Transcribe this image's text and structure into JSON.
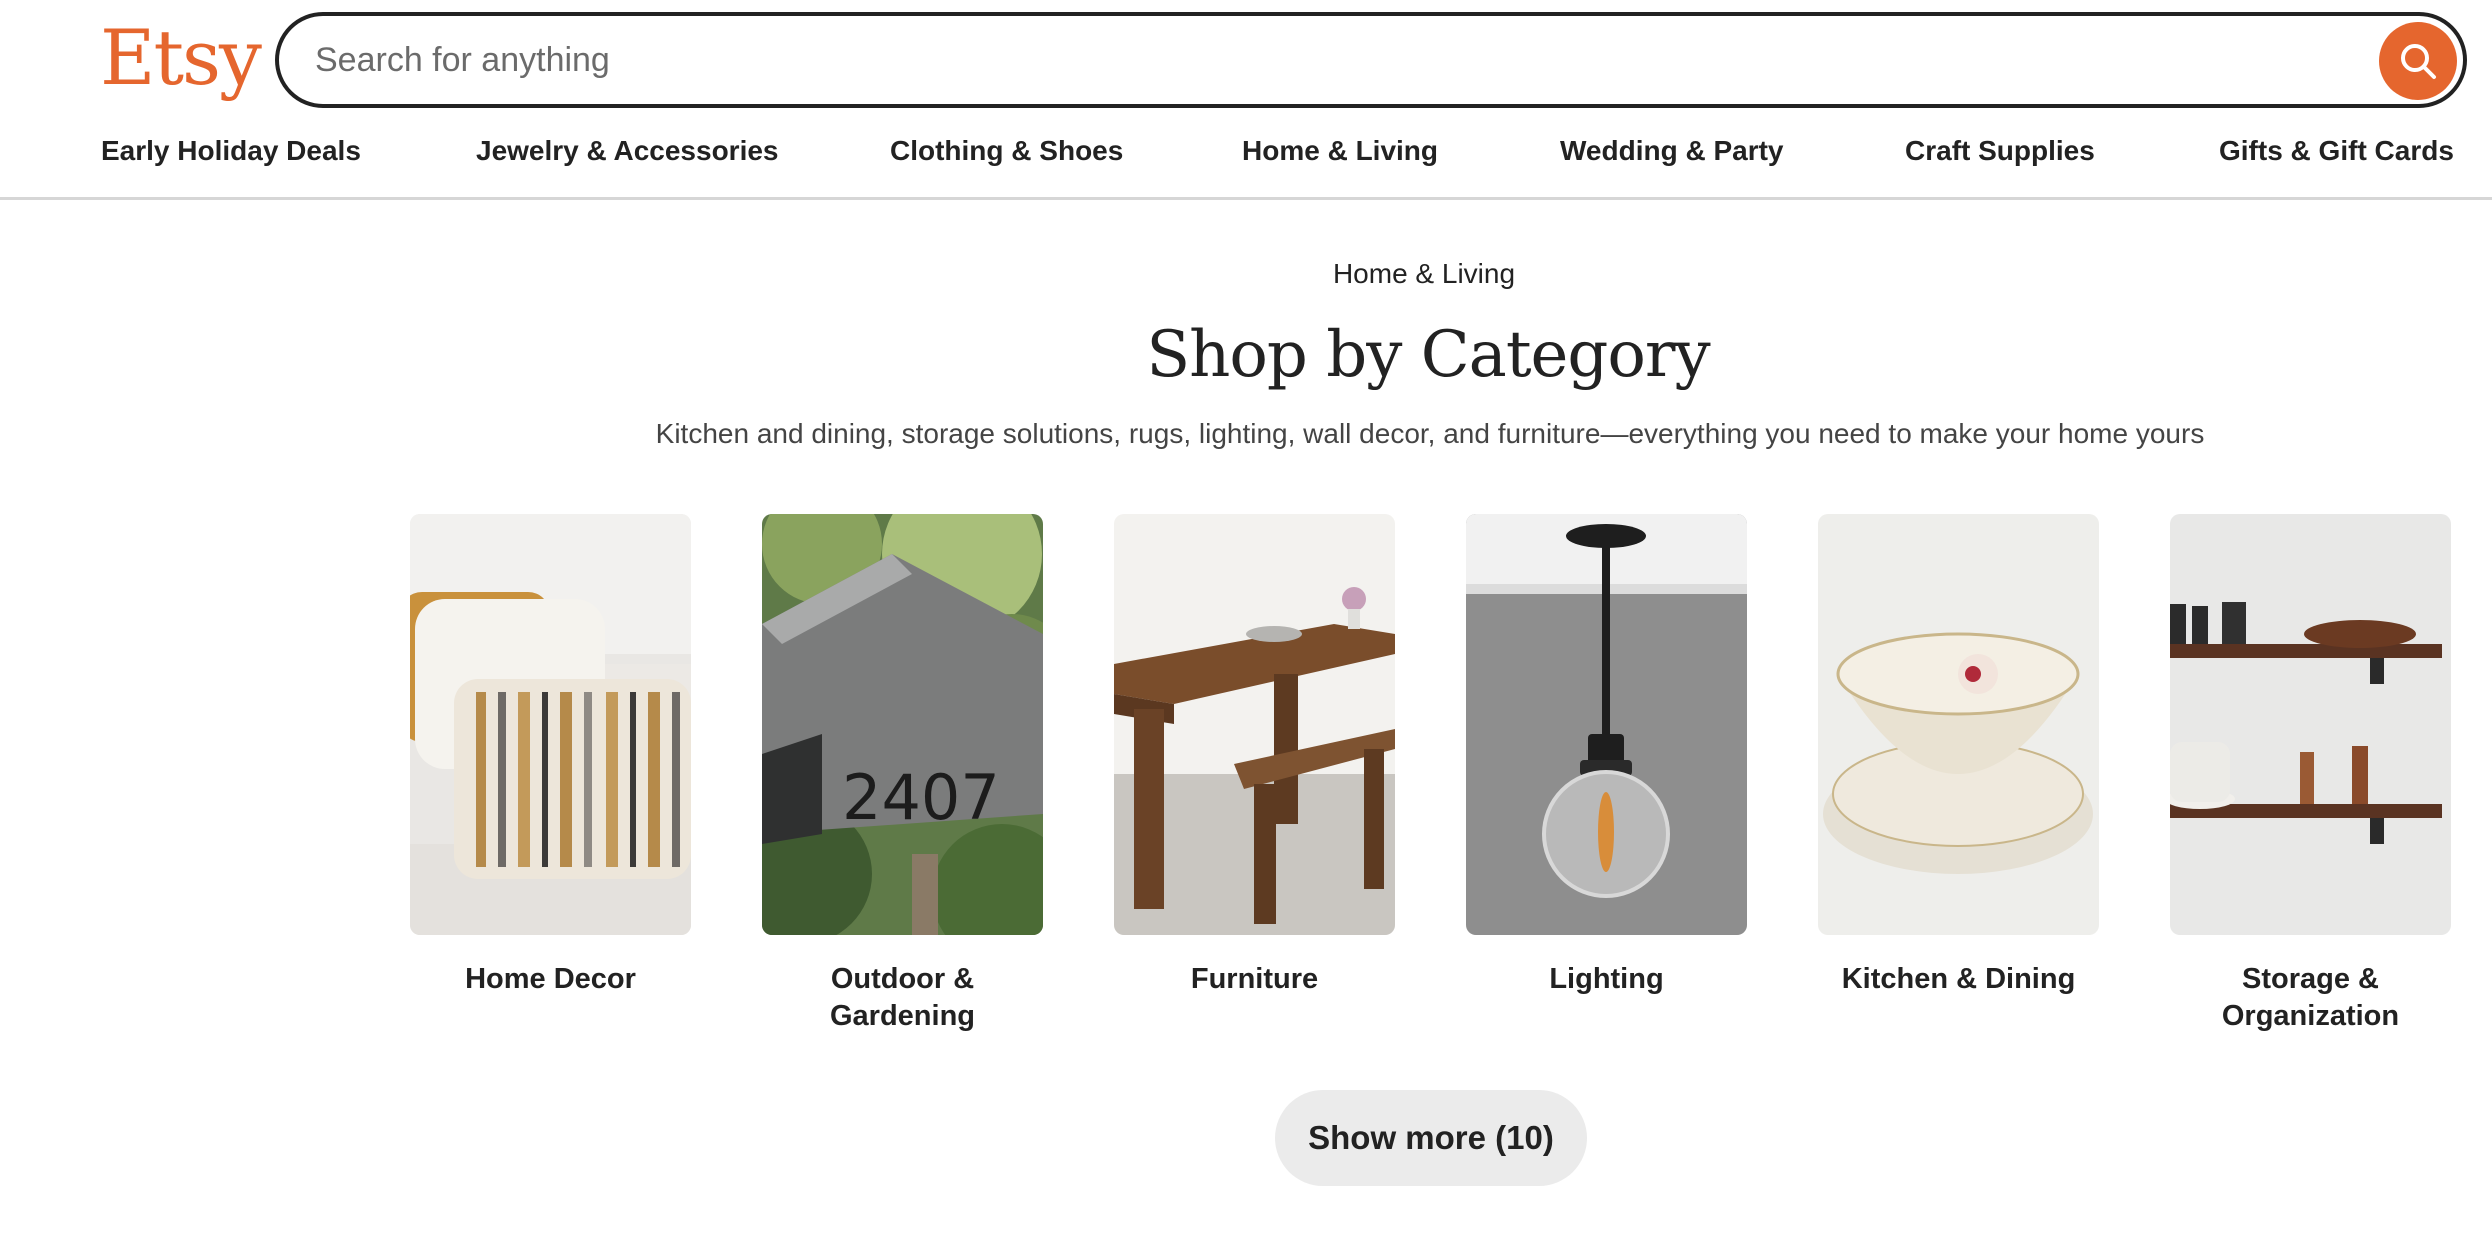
{
  "header": {
    "logo": "Etsy",
    "search_placeholder": "Search for anything",
    "search_button_icon": "search-icon",
    "accent_color": "#e5662e"
  },
  "nav": {
    "items": [
      "Early Holiday Deals",
      "Jewelry & Accessories",
      "Clothing & Shoes",
      "Home & Living",
      "Wedding & Party",
      "Craft Supplies",
      "Gifts & Gift Cards"
    ]
  },
  "main": {
    "breadcrumb": "Home & Living",
    "title": "Shop by Category",
    "subtitle": "Kitchen and dining, storage solutions, rugs, lighting, wall decor, and furniture—everything you need to make your home yours",
    "categories": [
      {
        "label": "Home Decor",
        "image": "pillows-photo"
      },
      {
        "label": "Outdoor & Gardening",
        "image": "mailbox-photo"
      },
      {
        "label": "Furniture",
        "image": "wood-table-photo"
      },
      {
        "label": "Lighting",
        "image": "pendant-lamp-photo"
      },
      {
        "label": "Kitchen & Dining",
        "image": "ceramic-bowl-photo"
      },
      {
        "label": "Storage & Organization",
        "image": "wall-shelves-photo"
      }
    ],
    "show_more_label": "Show more (10)"
  }
}
